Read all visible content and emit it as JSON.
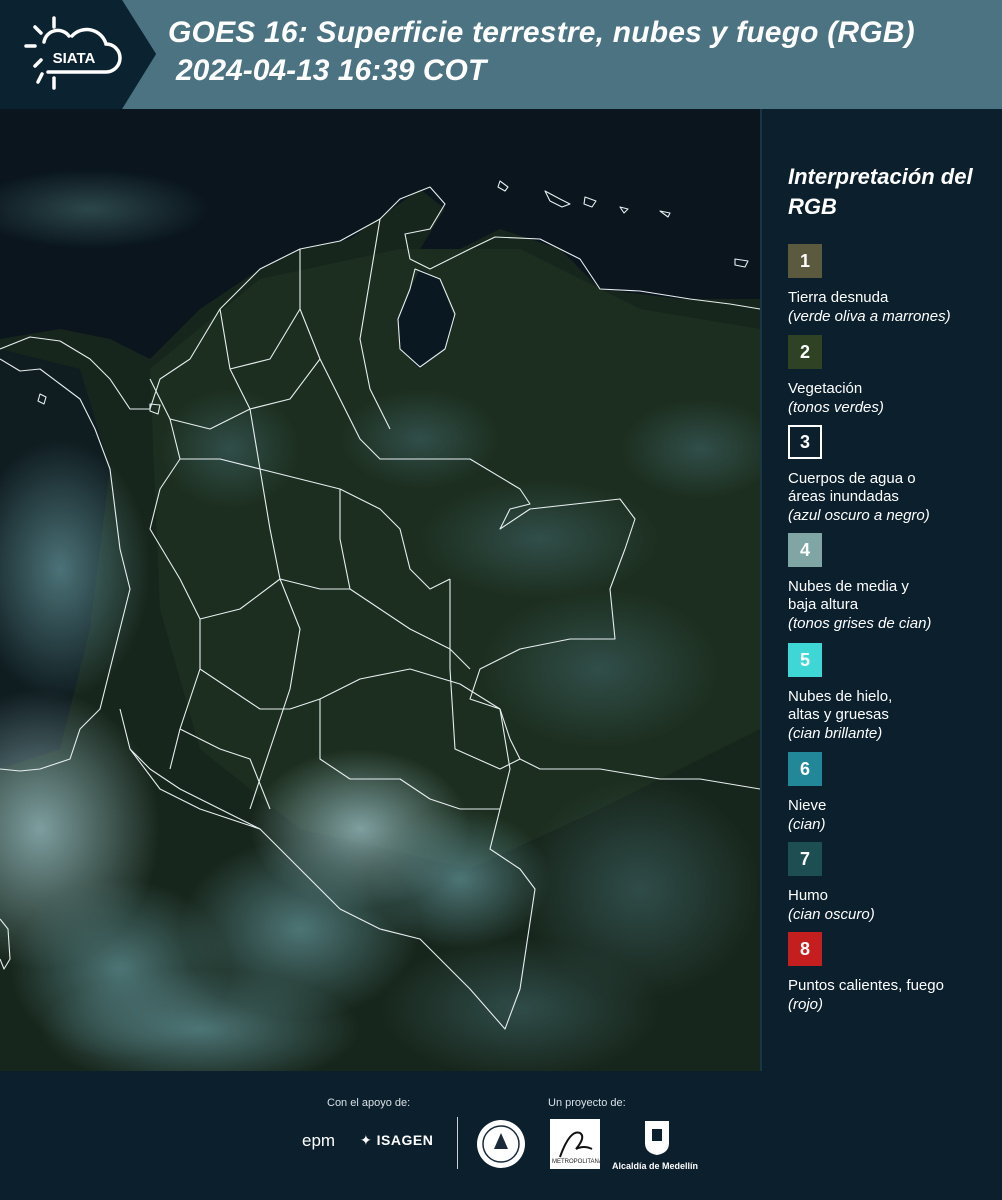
{
  "header": {
    "logo_text": "SIATA",
    "title_line1": "GOES 16: Superficie terrestre, nubes y fuego (RGB)",
    "title_line2": "2024-04-13 16:39 COT"
  },
  "legend": {
    "title": "Interpretación del RGB",
    "items": [
      {
        "number": "1",
        "label": "Tierra desnuda",
        "desc": "(verde oliva a marrones)",
        "color": "#5b5a3f"
      },
      {
        "number": "2",
        "label": "Vegetación",
        "desc": "(tonos verdes)",
        "color": "#2f4224"
      },
      {
        "number": "3",
        "label": "Cuerpos de agua o\náreas inundadas",
        "desc": "(azul oscuro a negro)",
        "color": "#0b1f2c"
      },
      {
        "number": "4",
        "label": "Nubes de media y\nbaja altura",
        "desc": "(tonos grises de cian)",
        "color": "#7fa6a5"
      },
      {
        "number": "5",
        "label": "Nubes de hielo,\naltas y gruesas",
        "desc": "(cian brillante)",
        "color": "#3fd6d6"
      },
      {
        "number": "6",
        "label": "Nieve",
        "desc": "(cian)",
        "color": "#23879a"
      },
      {
        "number": "7",
        "label": "Humo",
        "desc": "(cian oscuro)",
        "color": "#1d4f52"
      },
      {
        "number": "8",
        "label": "Puntos calientes, fuego",
        "desc": "(rojo)",
        "color": "#c41e1e"
      }
    ]
  },
  "footer": {
    "support_label": "Con el apoyo de:",
    "project_label": "Un proyecto de:",
    "sponsors": [
      "epm",
      "ISAGEN"
    ],
    "partners": [
      "Área Metropolitana",
      "Alcaldía de Medellín"
    ],
    "alcaldia_label": "Alcaldía de Medellín",
    "area_label": "METROPOLITANA"
  }
}
